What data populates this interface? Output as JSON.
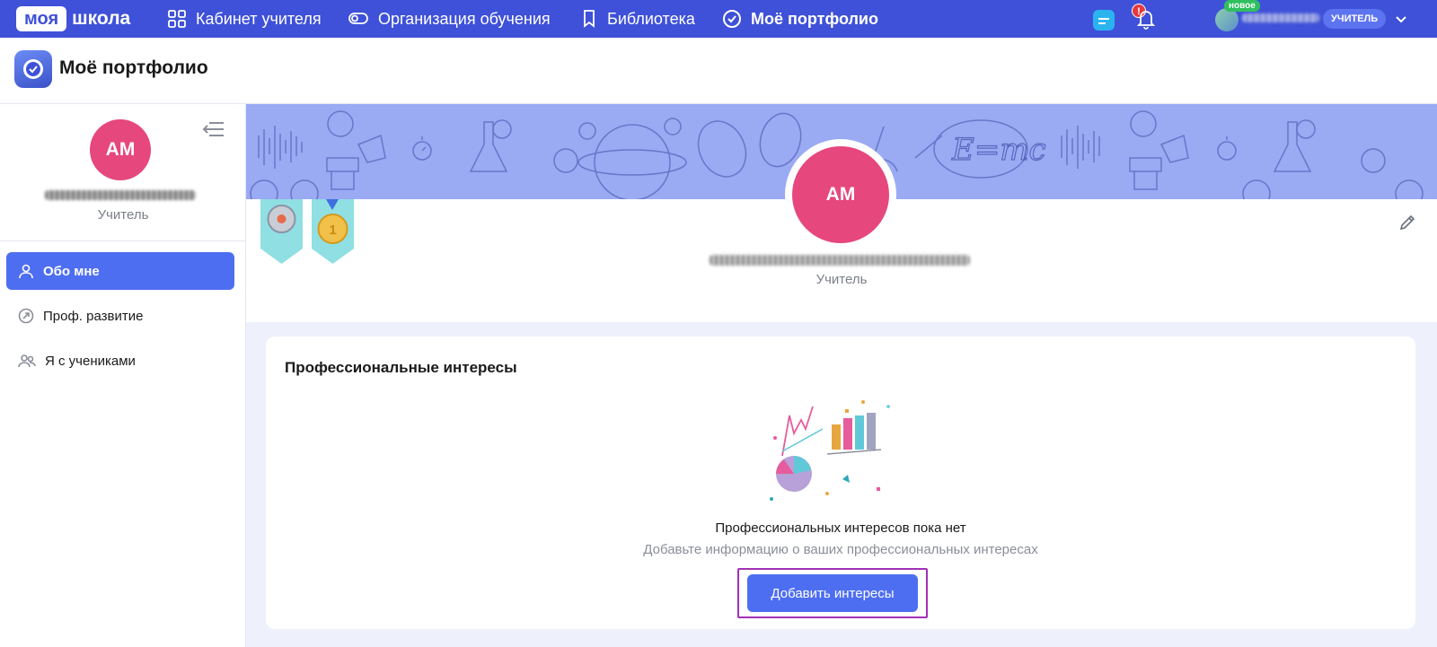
{
  "topbar": {
    "logo_box": "моя",
    "logo_text": "школа",
    "nav": [
      {
        "label": "Кабинет учителя",
        "icon": "grid-icon"
      },
      {
        "label": "Организация обучения",
        "icon": "toggle-icon"
      },
      {
        "label": "Библиотека",
        "icon": "bookmark-icon"
      },
      {
        "label": "Моё портфолио",
        "icon": "check-circle-icon",
        "active": true
      }
    ],
    "alert_badge": "!",
    "new_badge": "новое",
    "role_pill": "УЧИТЕЛЬ",
    "accent": "#3f51d8"
  },
  "page": {
    "title": "Моё портфолио"
  },
  "sidebar": {
    "avatar_initials": "АМ",
    "role": "Учитель",
    "menu": [
      {
        "label": "Обо мне",
        "icon": "person-icon",
        "active": true
      },
      {
        "label": "Проф. развитие",
        "icon": "growth-icon"
      },
      {
        "label": "Я с учениками",
        "icon": "people-icon"
      }
    ]
  },
  "profile": {
    "avatar_initials": "АМ",
    "role": "Учитель",
    "banner_formula": "E=mc",
    "avatar_color": "#e6477d"
  },
  "interests": {
    "title": "Профессиональные интересы",
    "empty_title": "Профессиональных интересов пока нет",
    "empty_subtitle": "Добавьте информацию о ваших профессиональных интересах",
    "add_button": "Добавить интересы"
  }
}
